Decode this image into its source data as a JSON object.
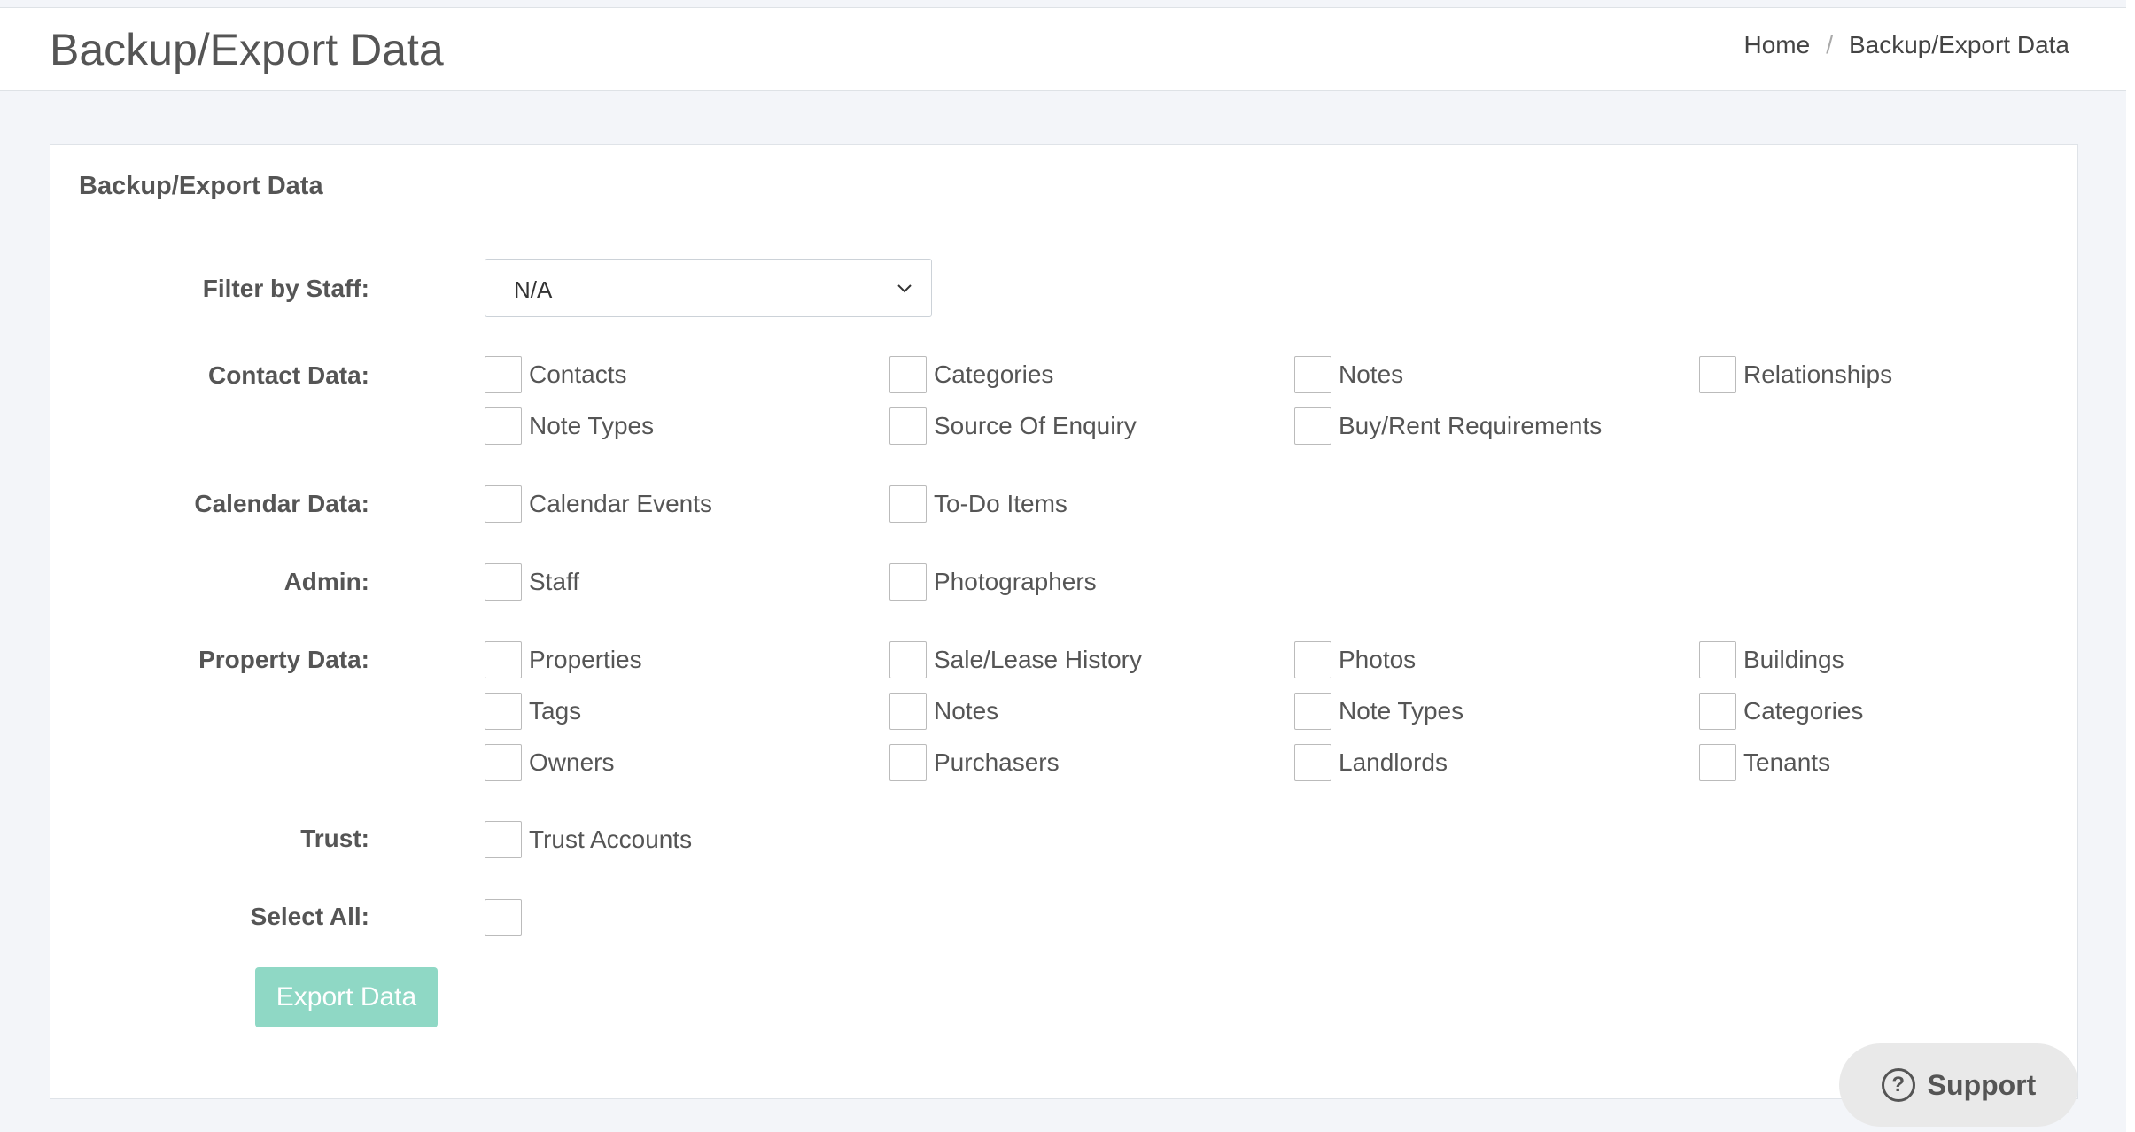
{
  "header": {
    "title": "Backup/Export Data",
    "breadcrumb": {
      "home": "Home",
      "separator": "/",
      "current": "Backup/Export Data"
    }
  },
  "card": {
    "title": "Backup/Export Data",
    "filter": {
      "label": "Filter by Staff:",
      "value": "N/A"
    },
    "sections": {
      "contact": {
        "label": "Contact Data:",
        "items": [
          "Contacts",
          "Categories",
          "Notes",
          "Relationships",
          "Note Types",
          "Source Of Enquiry",
          "Buy/Rent Requirements"
        ]
      },
      "calendar": {
        "label": "Calendar Data:",
        "items": [
          "Calendar Events",
          "To-Do Items"
        ]
      },
      "admin": {
        "label": "Admin:",
        "items": [
          "Staff",
          "Photographers"
        ]
      },
      "property": {
        "label": "Property Data:",
        "items": [
          "Properties",
          "Sale/Lease History",
          "Photos",
          "Buildings",
          "Tags",
          "Notes",
          "Note Types",
          "Categories",
          "Owners",
          "Purchasers",
          "Landlords",
          "Tenants"
        ]
      },
      "trust": {
        "label": "Trust:",
        "items": [
          "Trust Accounts"
        ]
      },
      "select_all": {
        "label": "Select All:"
      }
    },
    "export_button": "Export Data"
  },
  "support": {
    "label": "Support",
    "icon": "question-circle-icon"
  },
  "colors": {
    "accent": "#8fd8c5",
    "background": "#f3f5f9"
  }
}
